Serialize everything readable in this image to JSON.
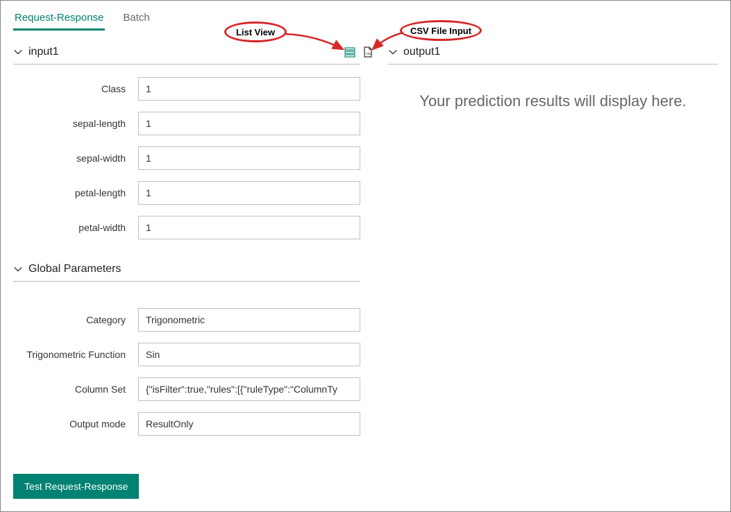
{
  "tabs": {
    "request_response": "Request-Response",
    "batch": "Batch"
  },
  "annotations": {
    "list_view": "List View",
    "csv_file_input": "CSV File Input"
  },
  "input_section": {
    "title": "input1",
    "fields": [
      {
        "label": "Class",
        "value": "1"
      },
      {
        "label": "sepal-length",
        "value": "1"
      },
      {
        "label": "sepal-width",
        "value": "1"
      },
      {
        "label": "petal-length",
        "value": "1"
      },
      {
        "label": "petal-width",
        "value": "1"
      }
    ]
  },
  "global_params": {
    "title": "Global Parameters",
    "fields": [
      {
        "label": "Category",
        "value": "Trigonometric"
      },
      {
        "label": "Trigonometric Function",
        "value": "Sin"
      },
      {
        "label": "Column Set",
        "value": "{\"isFilter\":true,\"rules\":[{\"ruleType\":\"ColumnTy"
      },
      {
        "label": "Output mode",
        "value": "ResultOnly"
      }
    ]
  },
  "output_section": {
    "title": "output1",
    "placeholder": "Your prediction results will display here."
  },
  "buttons": {
    "test": "Test Request-Response"
  },
  "icons": {
    "list_view": "list-view-icon",
    "csv_input": "csv-file-icon"
  }
}
